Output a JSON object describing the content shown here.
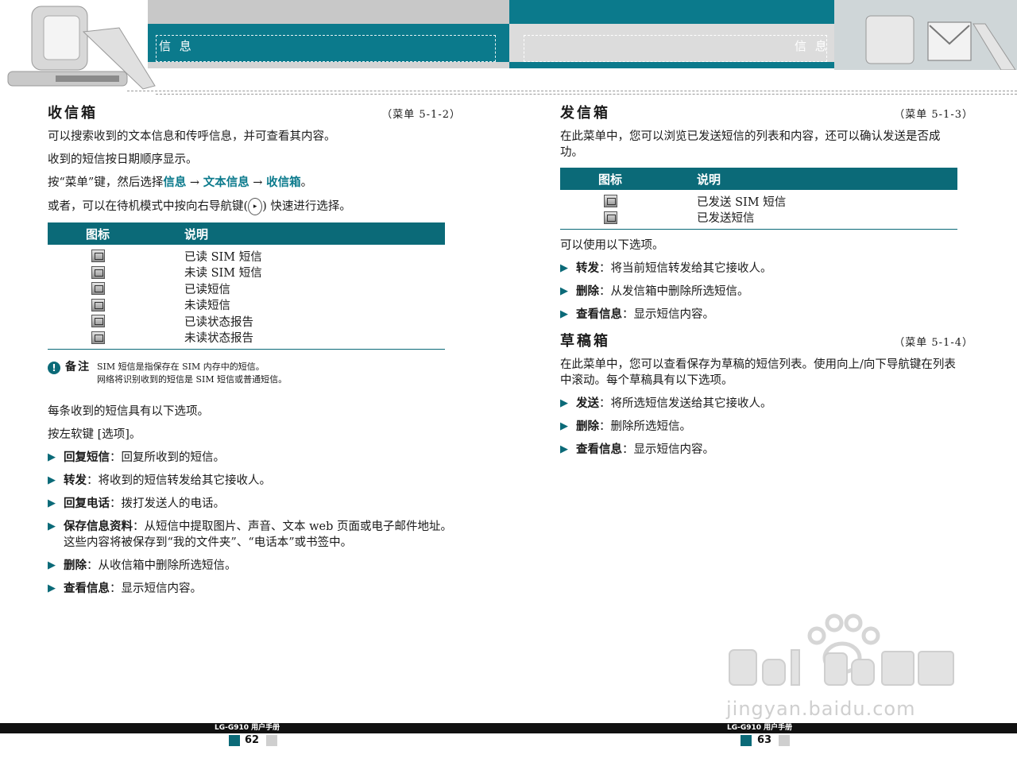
{
  "header": {
    "left_title": "信 息",
    "right_title": "信 息"
  },
  "left": {
    "title": "收信箱",
    "menu": "（菜单 5-1-2）",
    "intro": [
      "可以搜索收到的文本信息和传呼信息，并可查看其内容。",
      "收到的短信按日期顺序显示。"
    ],
    "path": {
      "prefix": "按“菜单”键，然后选择",
      "step1": "信息",
      "arrow1": " → ",
      "step2": "文本信息",
      "arrow2": " → ",
      "step3": "收信箱",
      "suffix": "。"
    },
    "nav_line": {
      "prefix": "或者，可以在待机模式中按向右导航键(",
      "suffix": ") 快速进行选择。"
    },
    "table": {
      "header_icon": "图标",
      "header_desc": "说明",
      "rows": [
        {
          "icon": "read-sim-message-icon",
          "desc": "已读 SIM 短信"
        },
        {
          "icon": "unread-sim-message-icon",
          "desc": "未读 SIM 短信"
        },
        {
          "icon": "read-message-icon",
          "desc": "已读短信"
        },
        {
          "icon": "unread-message-icon",
          "desc": "未读短信"
        },
        {
          "icon": "read-status-report-icon",
          "desc": "已读状态报告"
        },
        {
          "icon": "unread-status-report-icon",
          "desc": "未读状态报告"
        }
      ]
    },
    "note": {
      "label": "备注",
      "line1": "SIM 短信是指保存在 SIM 内存中的短信。",
      "line2": "网络将识别收到的短信是 SIM 短信或普通短信。"
    },
    "options_intro": [
      "每条收到的短信具有以下选项。",
      "按左软键 [选项]。"
    ],
    "options": [
      {
        "label": "回复短信",
        "text": "：回复所收到的短信。"
      },
      {
        "label": "转发",
        "text": "：将收到的短信转发给其它接收人。"
      },
      {
        "label": "回复电话",
        "text": "：拨打发送人的电话。"
      },
      {
        "label": "保存信息资料",
        "text": "：从短信中提取图片、声音、文本 web 页面或电子邮件地址。这些内容将被保存到“我的文件夹”、“电话本”或书签中。"
      },
      {
        "label": "删除",
        "text": "：从收信箱中删除所选短信。"
      },
      {
        "label": "查看信息",
        "text": "：显示短信内容。"
      }
    ]
  },
  "right": {
    "outbox": {
      "title": "发信箱",
      "menu": "（菜单 5-1-3）",
      "intro": "在此菜单中，您可以浏览已发送短信的列表和内容，还可以确认发送是否成功。",
      "table": {
        "header_icon": "图标",
        "header_desc": "说明",
        "rows": [
          {
            "icon": "sent-sim-message-icon",
            "desc": "已发送 SIM 短信"
          },
          {
            "icon": "sent-message-icon",
            "desc": "已发送短信"
          }
        ]
      },
      "options_intro": "可以使用以下选项。",
      "options": [
        {
          "label": "转发",
          "text": "：将当前短信转发给其它接收人。"
        },
        {
          "label": "删除",
          "text": "：从发信箱中删除所选短信。"
        },
        {
          "label": "查看信息",
          "text": "：显示短信内容。"
        }
      ]
    },
    "drafts": {
      "title": "草稿箱",
      "menu": "（菜单 5-1-4）",
      "intro": "在此菜单中，您可以查看保存为草稿的短信列表。使用向上/向下导航键在列表中滚动。每个草稿具有以下选项。",
      "options": [
        {
          "label": "发送",
          "text": "：将所选短信发送给其它接收人。"
        },
        {
          "label": "删除",
          "text": "：删除所选短信。"
        },
        {
          "label": "查看信息",
          "text": "：显示短信内容。"
        }
      ]
    }
  },
  "footer": {
    "left_caption": "LG-G910 用户手册",
    "left_page": "62",
    "right_caption": "LG-G910 用户手册",
    "right_page": "63"
  },
  "watermark": {
    "text": "jingyan.baidu.com"
  }
}
